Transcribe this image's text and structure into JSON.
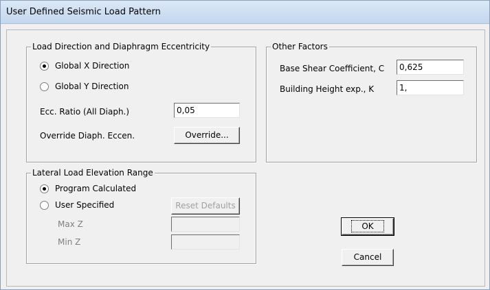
{
  "window": {
    "title": "User Defined Seismic Load Pattern"
  },
  "load_direction": {
    "legend": "Load Direction and Diaphragm Eccentricity",
    "options": [
      {
        "label": "Global X Direction",
        "selected": true
      },
      {
        "label": "Global Y Direction",
        "selected": false
      }
    ],
    "ecc_label": "Ecc. Ratio (All Diaph.)",
    "ecc_value": "0,05",
    "override_label": "Override Diaph. Eccen.",
    "override_button": "Override..."
  },
  "other_factors": {
    "legend": "Other Factors",
    "base_shear_label": "Base Shear Coefficient, C",
    "base_shear_value": "0,625",
    "height_exp_label": "Building Height exp., K",
    "height_exp_value": "1,"
  },
  "elevation_range": {
    "legend": "Lateral Load Elevation Range",
    "options": [
      {
        "label": "Program Calculated",
        "selected": true
      },
      {
        "label": "User Specified",
        "selected": false
      }
    ],
    "reset_button": "Reset Defaults",
    "max_z_label": "Max Z",
    "max_z_value": "",
    "min_z_label": "Min Z",
    "min_z_value": ""
  },
  "buttons": {
    "ok": "OK",
    "cancel": "Cancel"
  }
}
